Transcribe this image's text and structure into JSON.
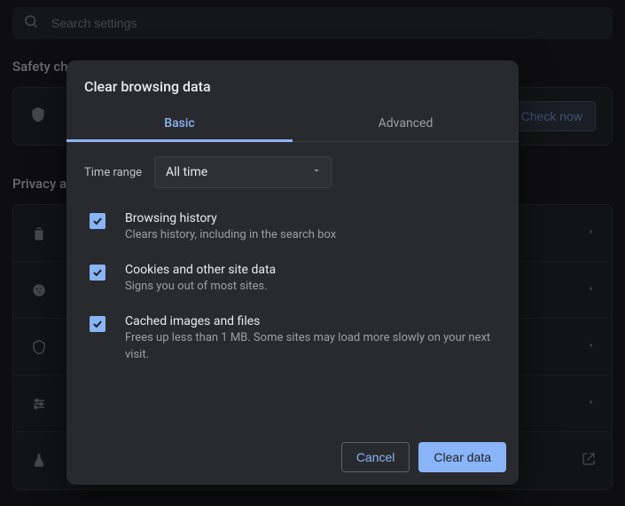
{
  "search": {
    "placeholder": "Search settings"
  },
  "sections": {
    "safety_title": "Safety check",
    "privacy_title": "Privacy and security",
    "check_now": "Check now"
  },
  "dialog": {
    "title": "Clear browsing data",
    "tabs": {
      "basic": "Basic",
      "advanced": "Advanced"
    },
    "time_range_label": "Time range",
    "time_range_value": "All time",
    "items": [
      {
        "title": "Browsing history",
        "sub": "Clears history, including in the search box",
        "checked": true
      },
      {
        "title": "Cookies and other site data",
        "sub": "Signs you out of most sites.",
        "checked": true
      },
      {
        "title": "Cached images and files",
        "sub": "Frees up less than 1 MB. Some sites may load more slowly on your next visit.",
        "checked": true
      }
    ],
    "cancel": "Cancel",
    "clear": "Clear data"
  }
}
